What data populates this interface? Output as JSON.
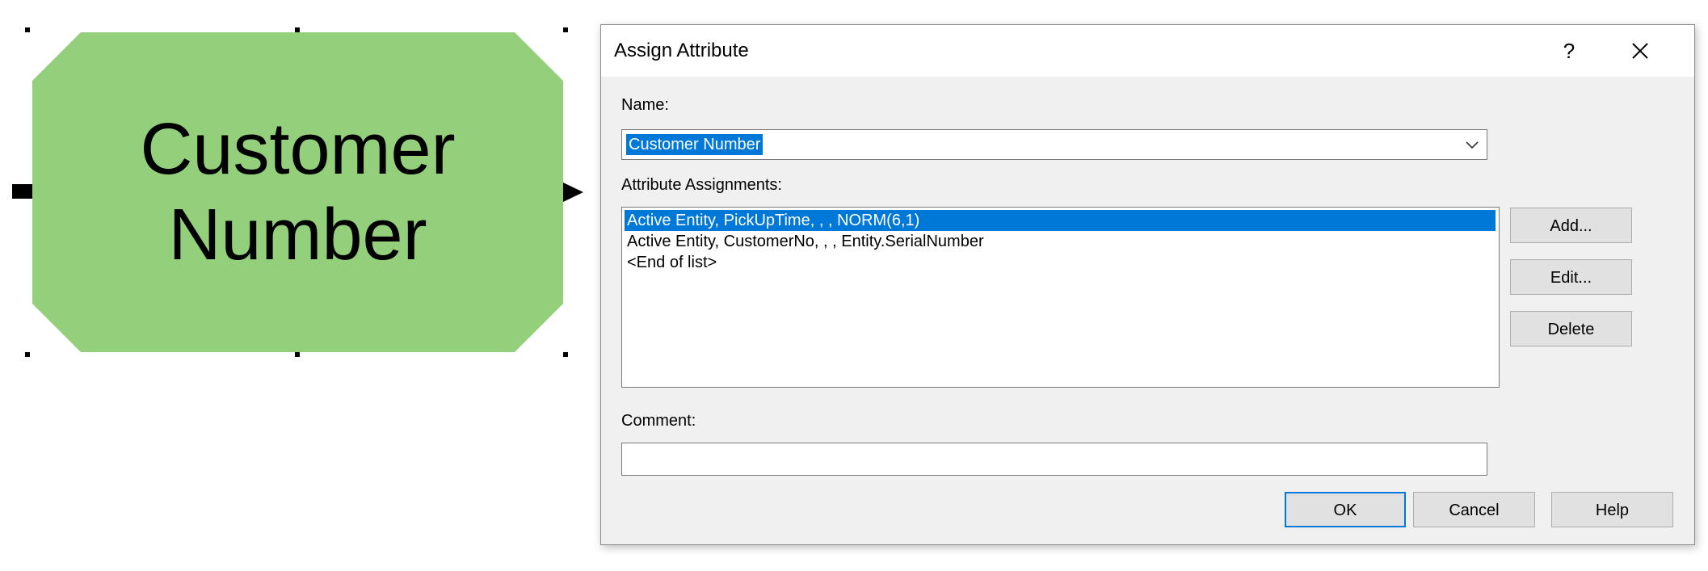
{
  "module": {
    "label": "Customer\nNumber",
    "fill_color": "#94d07c"
  },
  "dialog": {
    "title": "Assign Attribute",
    "help_label": "?",
    "close_icon": "close-x-icon",
    "name": {
      "label": "Name:",
      "value": "Customer Number",
      "dropdown_icon": "chevron-down-icon"
    },
    "assignments": {
      "label": "Attribute Assignments:",
      "items": [
        "Active Entity, PickUpTime, , , NORM(6,1)",
        "Active Entity, CustomerNo, , , Entity.SerialNumber",
        "<End of list>"
      ],
      "selected_index": 0
    },
    "side_buttons": {
      "add": "Add...",
      "edit": "Edit...",
      "delete": "Delete"
    },
    "comment": {
      "label": "Comment:",
      "value": ""
    },
    "footer_buttons": {
      "ok": "OK",
      "cancel": "Cancel",
      "help": "Help"
    },
    "accent_color": "#0078d7"
  }
}
